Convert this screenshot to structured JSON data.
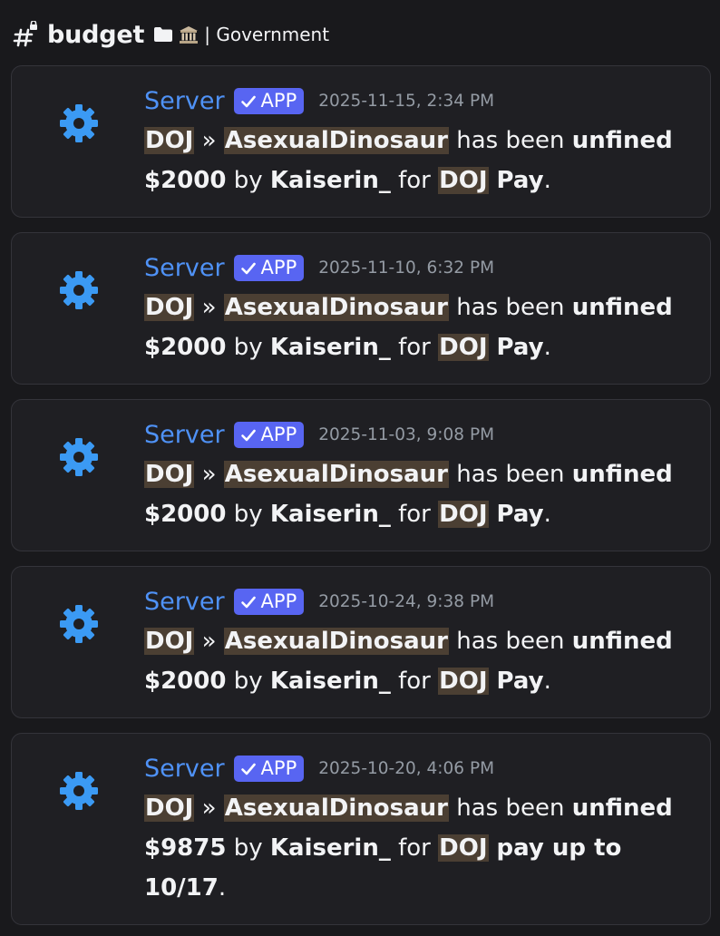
{
  "channel": {
    "name": "budget",
    "category": "Government",
    "icons": [
      "hash-lock-icon",
      "folder-icon",
      "classical-building-icon"
    ]
  },
  "colors": {
    "background": "#19191c",
    "card": "#1f1f23",
    "author": "#4f92f7",
    "badge": "#5865f2",
    "mention_highlight": "#4b3f33",
    "timestamp": "#949ba4",
    "gear": "#3b9af4"
  },
  "messages": [
    {
      "author": "Server",
      "badge": "APP",
      "timestamp": "2025-11-15, 2:34 PM",
      "icon": "gear-icon",
      "parts": {
        "dept": "DOJ",
        "sep": " » ",
        "user": "AsexualDinosaur",
        "t1": " has been ",
        "action": "unfined",
        "amount": "$2000",
        "t2": " by ",
        "actor": "Kaiserin_",
        "t3": " for ",
        "dept2": "DOJ",
        "reason": " Pay",
        "end": "."
      }
    },
    {
      "author": "Server",
      "badge": "APP",
      "timestamp": "2025-11-10, 6:32 PM",
      "icon": "gear-icon",
      "parts": {
        "dept": "DOJ",
        "sep": " » ",
        "user": "AsexualDinosaur",
        "t1": " has been ",
        "action": "unfined",
        "amount": "$2000",
        "t2": " by ",
        "actor": "Kaiserin_",
        "t3": " for ",
        "dept2": "DOJ",
        "reason": " Pay",
        "end": "."
      }
    },
    {
      "author": "Server",
      "badge": "APP",
      "timestamp": "2025-11-03, 9:08 PM",
      "icon": "gear-icon",
      "parts": {
        "dept": "DOJ",
        "sep": " » ",
        "user": "AsexualDinosaur",
        "t1": " has been ",
        "action": "unfined",
        "amount": "$2000",
        "t2": " by ",
        "actor": "Kaiserin_",
        "t3": " for ",
        "dept2": "DOJ",
        "reason": " Pay",
        "end": "."
      }
    },
    {
      "author": "Server",
      "badge": "APP",
      "timestamp": "2025-10-24, 9:38 PM",
      "icon": "gear-icon",
      "parts": {
        "dept": "DOJ",
        "sep": " » ",
        "user": "AsexualDinosaur",
        "t1": " has been ",
        "action": "unfined",
        "amount": "$2000",
        "t2": " by ",
        "actor": "Kaiserin_",
        "t3": " for ",
        "dept2": "DOJ",
        "reason": " Pay",
        "end": "."
      }
    },
    {
      "author": "Server",
      "badge": "APP",
      "timestamp": "2025-10-20, 4:06 PM",
      "icon": "gear-icon",
      "parts": {
        "dept": "DOJ",
        "sep": " » ",
        "user": "AsexualDinosaur",
        "t1": " has been ",
        "action": "unfined",
        "amount": "$9875",
        "t2": " by ",
        "actor": "Kaiserin_",
        "t3": " for ",
        "dept2": "DOJ",
        "reason": " pay up to 10/17",
        "end": "."
      }
    }
  ]
}
